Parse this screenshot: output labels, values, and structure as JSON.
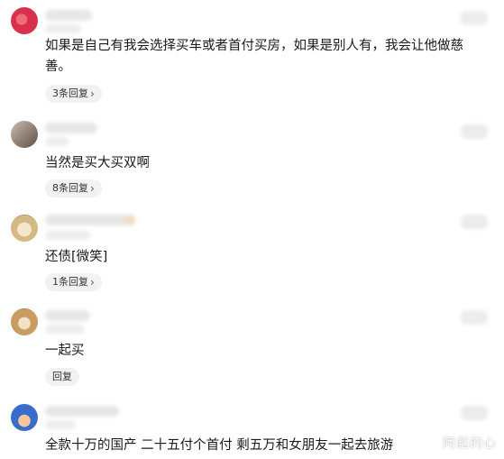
{
  "comments": [
    {
      "text": "如果是自己有我会选择买车或者首付买房，如果是别人有，我会让他做慈善。",
      "reply": "3条回复",
      "avatar_color": "#d9314b"
    },
    {
      "text": "当然是买大买双啊",
      "reply": "8条回复",
      "avatar_color": "#9c8c80"
    },
    {
      "text": "还债[微笑]",
      "reply": "1条回复",
      "avatar_color": "#e8d3a5"
    },
    {
      "text": "一起买",
      "reply": "回复",
      "avatar_color": "#c7a06b"
    },
    {
      "text": "全款十万的国产 二十五付个首付 剩五万和女朋友一起去旅游",
      "reply": "",
      "avatar_color": "#3a6cc9"
    }
  ],
  "watermark": "阿彪的心"
}
